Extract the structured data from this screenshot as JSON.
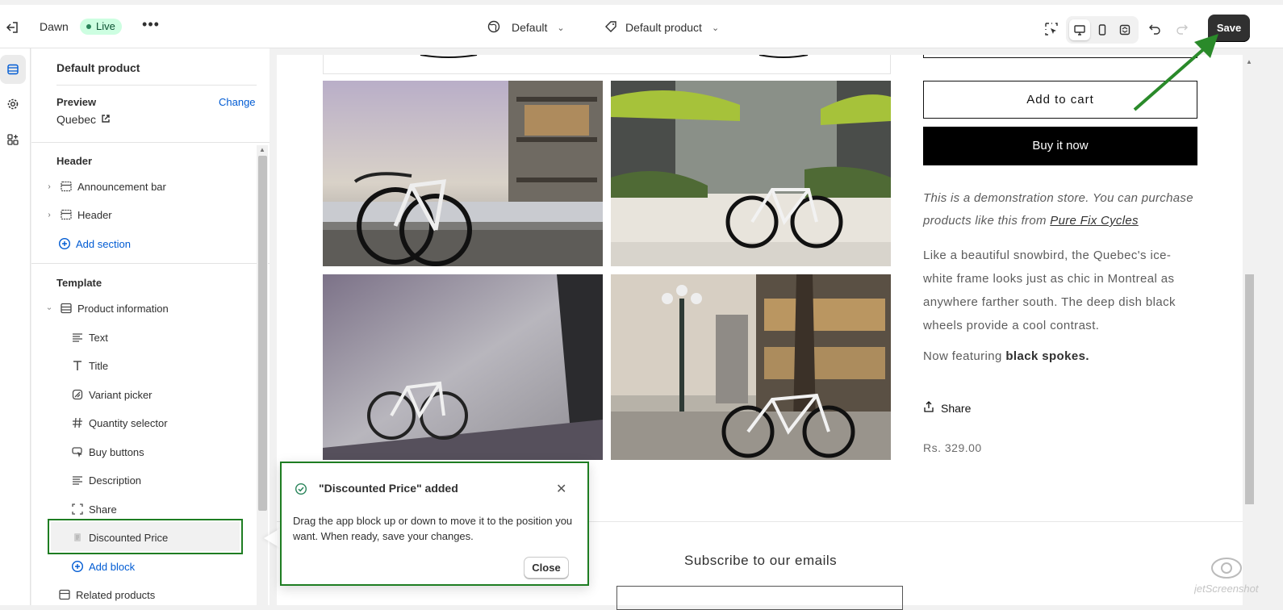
{
  "topbar": {
    "theme_name": "Dawn",
    "status_badge": "Live",
    "more_label": "•••",
    "template_selector": "Default",
    "product_selector": "Default product",
    "save_label": "Save"
  },
  "panel": {
    "heading": "Default product",
    "preview_label": "Preview",
    "change_label": "Change",
    "preview_value": "Quebec",
    "header_section": "Header",
    "header_items": [
      "Announcement bar",
      "Header"
    ],
    "add_section": "Add section",
    "template_section": "Template",
    "product_information": "Product information",
    "blocks": [
      "Text",
      "Title",
      "Variant picker",
      "Quantity selector",
      "Buy buttons",
      "Description",
      "Share",
      "Discounted Price"
    ],
    "add_block": "Add block",
    "related_products": "Related products"
  },
  "product": {
    "add_to_cart": "Add to cart",
    "buy_now": "Buy it now",
    "demo_text": "This is a demonstration store. You can purchase products like this from ",
    "demo_link": "Pure Fix Cycles",
    "description": "Like a beautiful snowbird, the Quebec's ice-white frame looks just as chic in Montreal as anywhere farther south. The deep dish black wheels provide a cool contrast.",
    "feature_prefix": "Now featuring ",
    "feature_bold": "black spokes.",
    "share": "Share",
    "price": "Rs. 329.00"
  },
  "footer": {
    "subscribe": "Subscribe to our emails"
  },
  "toast": {
    "title": "\"Discounted Price\" added",
    "body": "Drag the app block up or down to move it to the position you want. When ready, save your changes.",
    "close_label": "Close"
  },
  "watermark": "jetScreenshot",
  "colors": {
    "accent_blue": "#005bd3",
    "annotation_green": "#1e7d22",
    "live_bg": "#cdfee1",
    "save_bg": "#303030"
  }
}
